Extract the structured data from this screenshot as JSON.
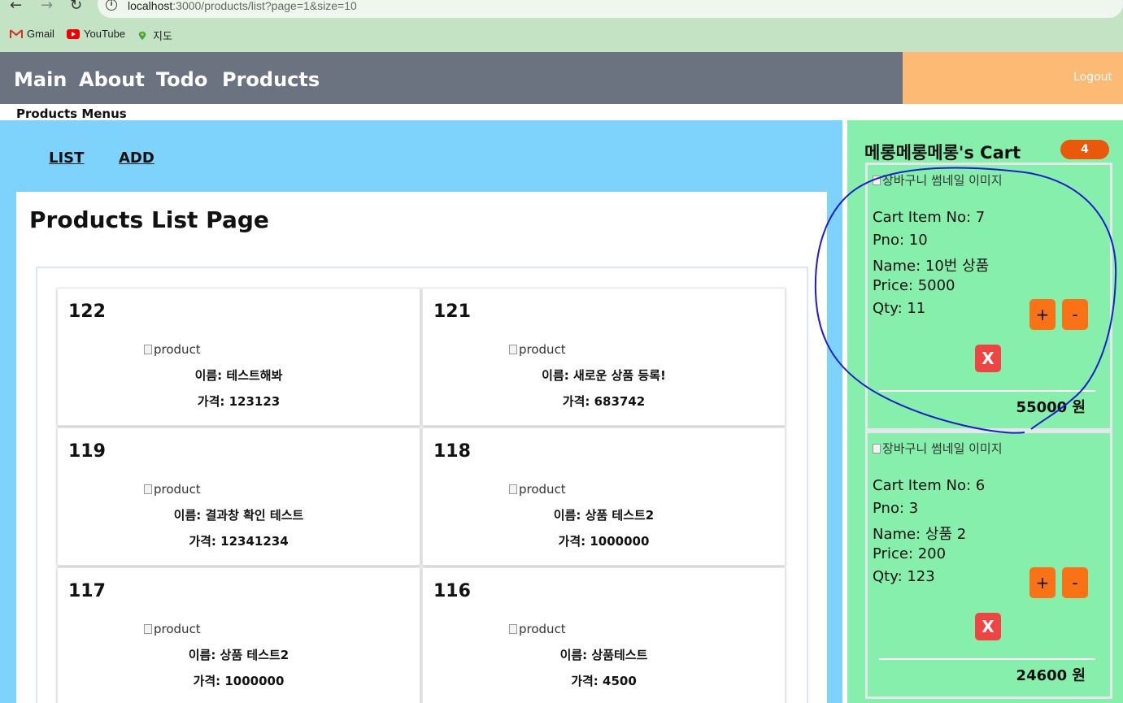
{
  "browser": {
    "url_host": "localhost",
    "url_rest": ":3000/products/list?page=1&size=10",
    "bookmarks": [
      {
        "label": "Gmail",
        "icon": "gmail-icon"
      },
      {
        "label": "YouTube",
        "icon": "youtube-icon"
      },
      {
        "label": "지도",
        "icon": "maps-icon"
      }
    ]
  },
  "nav": {
    "links": [
      "Main",
      "About",
      "Todo",
      "Products"
    ],
    "logout": "Logout"
  },
  "sub_title": "Products Menus",
  "menu": {
    "list": "LIST",
    "add": "ADD"
  },
  "page_title": "Products List Page",
  "products": [
    {
      "no": "122",
      "img_alt": "product",
      "name": "이름: 테스트해봐",
      "price": "가격: 123123"
    },
    {
      "no": "121",
      "img_alt": "product",
      "name": "이름: 새로운 상품 등록!",
      "price": "가격: 683742"
    },
    {
      "no": "119",
      "img_alt": "product",
      "name": "이름: 결과창 확인 테스트",
      "price": "가격: 12341234"
    },
    {
      "no": "118",
      "img_alt": "product",
      "name": "이름: 상품 테스트2",
      "price": "가격: 1000000"
    },
    {
      "no": "117",
      "img_alt": "product",
      "name": "이름: 상품 테스트2",
      "price": "가격: 1000000"
    },
    {
      "no": "116",
      "img_alt": "product",
      "name": "이름: 상품테스트",
      "price": "가격: 4500"
    }
  ],
  "cart": {
    "title": "메롱메롱메롱's Cart",
    "count": "4",
    "items": [
      {
        "img_alt": "장바구니 썸네일 이미지",
        "cino": "Cart Item No: 7",
        "pno": "Pno: 10",
        "name": "Name: 10번 상품",
        "price": "Price: 5000",
        "qty": "Qty: 11",
        "plus": "+",
        "minus": "-",
        "delete": "X",
        "total": "55000 원"
      },
      {
        "img_alt": "장바구니 썸네일 이미지",
        "cino": "Cart Item No: 6",
        "pno": "Pno: 3",
        "name": "Name: 상품 2",
        "price": "Price: 200",
        "qty": "Qty: 123",
        "plus": "+",
        "minus": "-",
        "delete": "X",
        "total": "24600 원"
      }
    ]
  },
  "colors": {
    "nav_bg": "#6b7280",
    "logout_bg": "#fdba74",
    "main_bg": "#7dd3fc",
    "cart_bg": "#86efac",
    "badge": "#ea580c",
    "qty_btn": "#f97316",
    "delete_btn": "#ef4444",
    "annotation": "#1d1dcc"
  }
}
